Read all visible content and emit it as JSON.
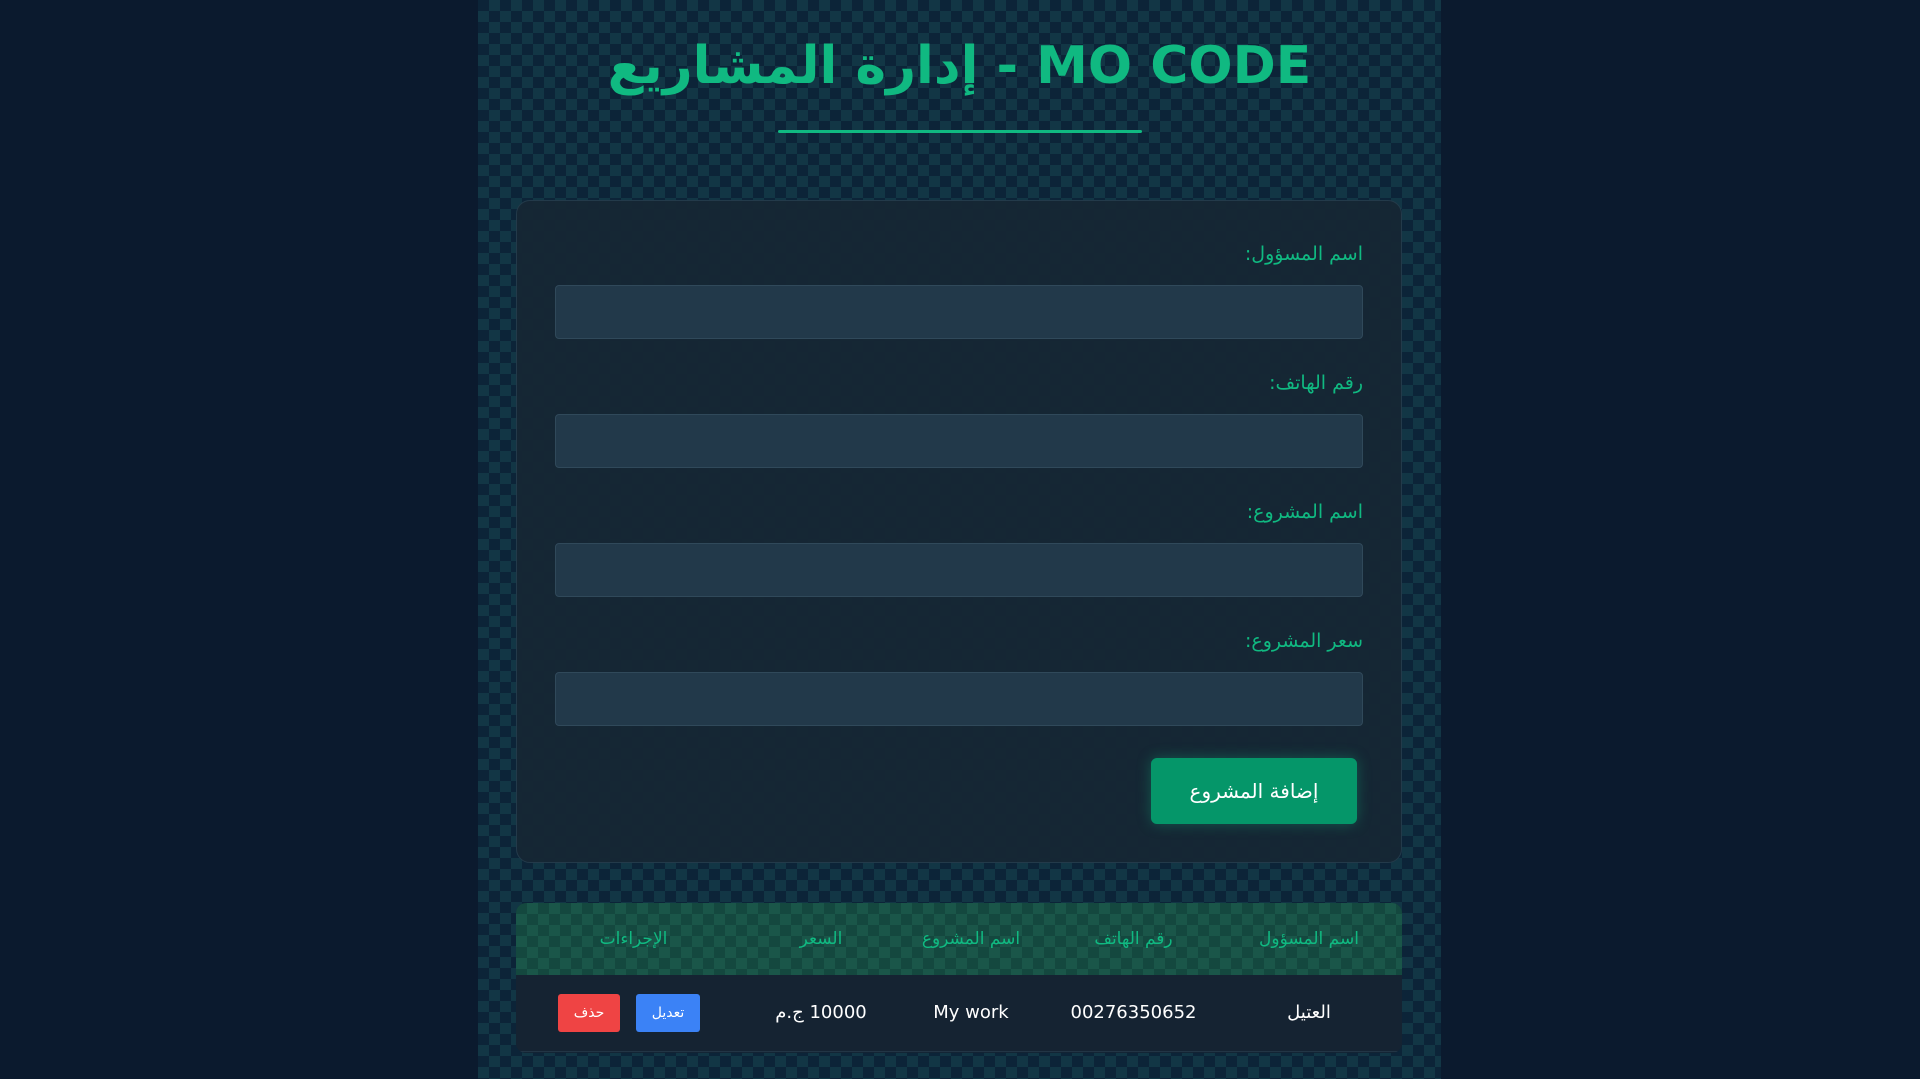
{
  "header": {
    "title": "إدارة المشاريع - MO CODE"
  },
  "form": {
    "manager_label": "اسم المسؤول:",
    "manager_value": "",
    "phone_label": "رقم الهاتف:",
    "phone_value": "",
    "project_name_label": "اسم المشروع:",
    "project_name_value": "",
    "project_price_label": "سعر المشروع:",
    "project_price_value": "",
    "submit_label": "إضافة المشروع"
  },
  "table": {
    "headers": {
      "manager": "اسم المسؤول",
      "phone": "رقم الهاتف",
      "project": "اسم المشروع",
      "price": "السعر",
      "actions": "الإجراءات"
    },
    "rows": [
      {
        "manager": "العتيل",
        "phone": "00276350652",
        "project": "My work",
        "price": "10000 ج.م",
        "edit_label": "تعديل",
        "delete_label": "حذف"
      }
    ]
  },
  "colors": {
    "accent": "#10b981",
    "submit": "#059669",
    "edit": "#3b82f6",
    "delete": "#ef4444",
    "background": "#0b1a2e"
  }
}
